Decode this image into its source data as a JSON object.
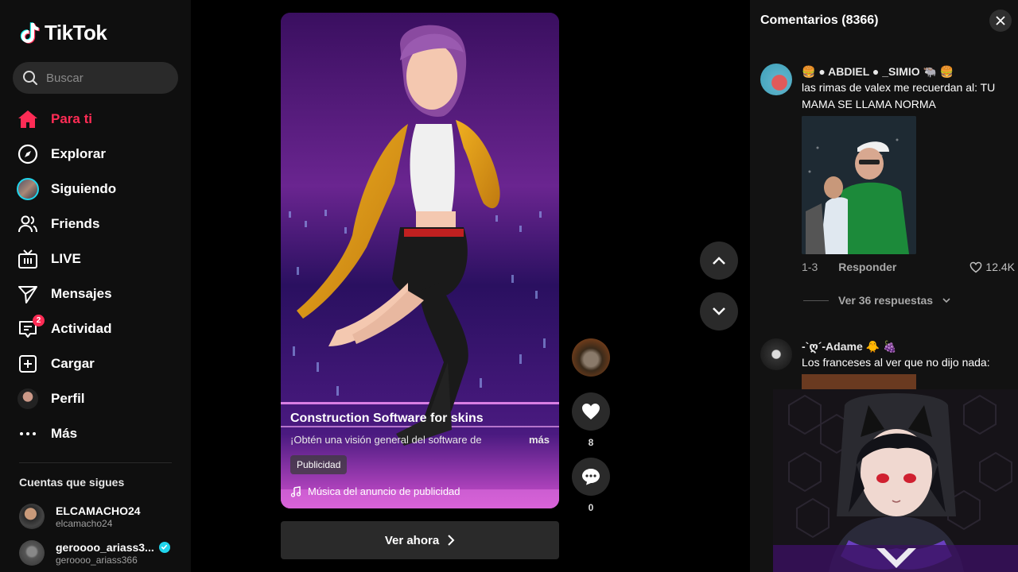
{
  "app": {
    "name": "TikTok"
  },
  "search": {
    "placeholder": "Buscar"
  },
  "nav": [
    {
      "label": "Para ti",
      "icon": "home-icon",
      "active": true
    },
    {
      "label": "Explorar",
      "icon": "compass-icon"
    },
    {
      "label": "Siguiendo",
      "icon": "following-avatar"
    },
    {
      "label": "Friends",
      "icon": "friends-icon"
    },
    {
      "label": "LIVE",
      "icon": "live-icon"
    },
    {
      "label": "Mensajes",
      "icon": "messages-icon"
    },
    {
      "label": "Actividad",
      "icon": "activity-icon",
      "badge": "2"
    },
    {
      "label": "Cargar",
      "icon": "upload-icon"
    },
    {
      "label": "Perfil",
      "icon": "profile-avatar"
    },
    {
      "label": "Más",
      "icon": "more-icon"
    }
  ],
  "following": {
    "title": "Cuentas que sigues",
    "accounts": [
      {
        "name": "ELCAMACHO24",
        "handle": "elcamacho24",
        "verified": false
      },
      {
        "name": "geroooo_ariass3...",
        "handle": "geroooo_ariass366",
        "verified": true
      }
    ]
  },
  "video": {
    "title": "Construction Software for skins",
    "description": "¡Obtén una visión general del software de",
    "more": "más",
    "ad_label": "Publicidad",
    "music": "Música del anuncio de publicidad",
    "cta": "Ver ahora"
  },
  "actions": {
    "likes": "8",
    "comments": "0"
  },
  "comments_panel": {
    "title": "Comentarios",
    "count": "(8366)",
    "items": [
      {
        "user": "🍔 ● ABDIEL ● _SIMIO 🐃 🍔",
        "text": "las rimas de valex me recuerdan al: TU MAMA SE LLAMA NORMA",
        "date": "1-3",
        "reply": "Responder",
        "likes": "12.4K",
        "view_replies": "Ver 36 respuestas"
      },
      {
        "user": "-`ღ´-Adame 🐥 🍇",
        "text": "Los franceses al ver que no dijo nada:"
      }
    ]
  },
  "colors": {
    "accent": "#fe2c55",
    "verified": "#20d5ec",
    "background": "#000000"
  }
}
